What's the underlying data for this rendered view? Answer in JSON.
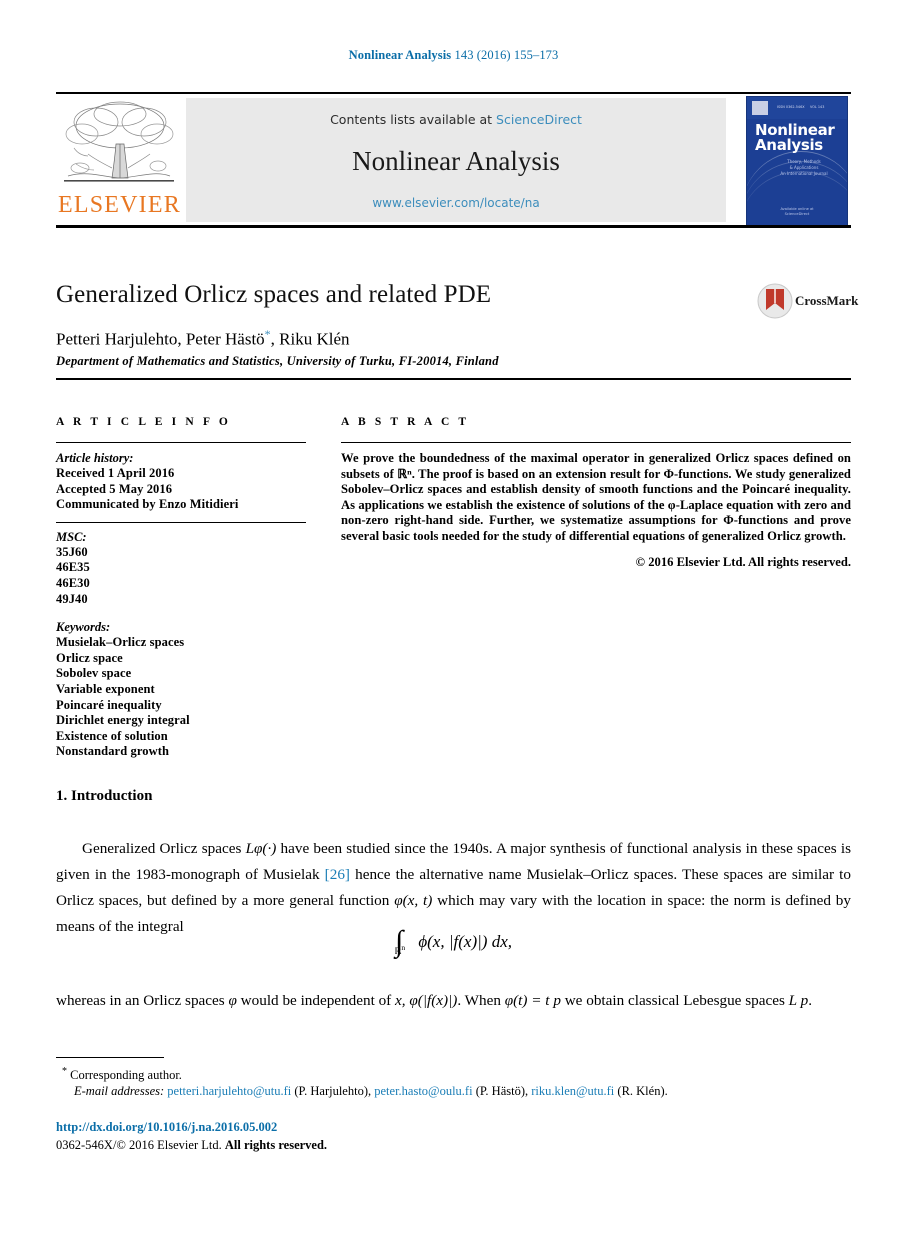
{
  "running_head": {
    "journal": "Nonlinear Analysis",
    "citation": " 143 (2016) 155–173"
  },
  "masthead": {
    "contents_prefix": "Contents lists available at ",
    "contents_link": "ScienceDirect",
    "journal_title": "Nonlinear Analysis",
    "journal_url": "www.elsevier.com/locate/na",
    "publisher_wordmark": "ELSEVIER",
    "cover": {
      "title_line1": "Nonlinear",
      "title_line2": "Analysis",
      "subtitle": "Theory, Methods &amp; Applications\nAn International Multidisciplinary Journal",
      "footer": "Available online at www.sciencedirect.com\nScienceDirect"
    }
  },
  "article": {
    "title": "Generalized Orlicz spaces and related PDE",
    "authors": "Petteri Harjulehto, Peter Hästö",
    "authors_tail": ", Riku Klén",
    "corresponding_marker": "*",
    "affiliation": "Department of Mathematics and Statistics, University of Turku, FI-20014, Finland",
    "crossmark_label": "CrossMark"
  },
  "info": {
    "heading": "A R T I C L E   I N F O",
    "history_label": "Article history:",
    "history": [
      "Received 1 April 2016",
      "Accepted 5 May 2016",
      "Communicated by Enzo Mitidieri"
    ],
    "msc_label": "MSC:",
    "msc": [
      "35J60",
      "46E35",
      "46E30",
      "49J40"
    ],
    "keywords_label": "Keywords:",
    "keywords": [
      "Musielak–Orlicz spaces",
      "Orlicz space",
      "Sobolev space",
      "Variable exponent",
      "Poincaré inequality",
      "Dirichlet energy integral",
      "Existence of solution",
      "Nonstandard growth"
    ]
  },
  "abstract": {
    "heading": "A B S T R A C T",
    "text": "We prove the boundedness of the maximal operator in generalized Orlicz spaces defined on subsets of ℝⁿ. The proof is based on an extension result for Φ-functions. We study generalized Sobolev–Orlicz spaces and establish density of smooth functions and the Poincaré inequality. As applications we establish the existence of solutions of the φ-Laplace equation with zero and non-zero right-hand side. Further, we systematize assumptions for Φ-functions and prove several basic tools needed for the study of differential equations of generalized Orlicz growth.",
    "copyright": "© 2016 Elsevier Ltd. All rights reserved."
  },
  "body": {
    "section_heading": "1.  Introduction",
    "para1_a": "Generalized Orlicz spaces ",
    "para1_math1": "Lφ(·)",
    "para1_b": " have been studied since the 1940s. A major synthesis of functional analysis in these spaces is given in the 1983-monograph of Musielak ",
    "citation": "[26]",
    "para1_c": " hence the alternative name Musielak–Orlicz spaces. These spaces are similar to Orlicz spaces, but defined by a more general function ",
    "para1_math2": "φ(x, t)",
    "para1_d": " which may vary with the location in space: the norm is defined by means of the integral",
    "equation": "∫ℝn φ(x, |f(x)|) dx,",
    "para2_a": "whereas in an Orlicz spaces ",
    "para2_math1": "φ",
    "para2_b": " would be independent of ",
    "para2_math2": "x, φ(|f(x)|)",
    "para2_c": ". When ",
    "para2_math3": "φ(t) = t p",
    "para2_d": " we obtain classical Lebesgue spaces ",
    "para2_math4": "L p",
    "para2_e": "."
  },
  "footnotes": {
    "corresponding": "Corresponding author.",
    "email_label": "E-mail addresses:",
    "emails": [
      {
        "address": "petteri.harjulehto@utu.fi",
        "owner": "(P. Harjulehto),"
      },
      {
        "address": "peter.hasto@oulu.fi",
        "owner": "(P. Hästö),"
      },
      {
        "address": "riku.klen@utu.fi",
        "owner": "(R. Klén)."
      }
    ],
    "doi": "http://dx.doi.org/10.1016/j.na.2016.05.002",
    "issn_prefix": "0362-546X/© 2016 Elsevier Ltd. ",
    "issn_rights": "All rights reserved."
  },
  "colors": {
    "link": "#1a7db6",
    "header_blue": "#0b6ea8",
    "elsevier_orange": "#e87722",
    "cover_blue": "#1c3f94"
  }
}
